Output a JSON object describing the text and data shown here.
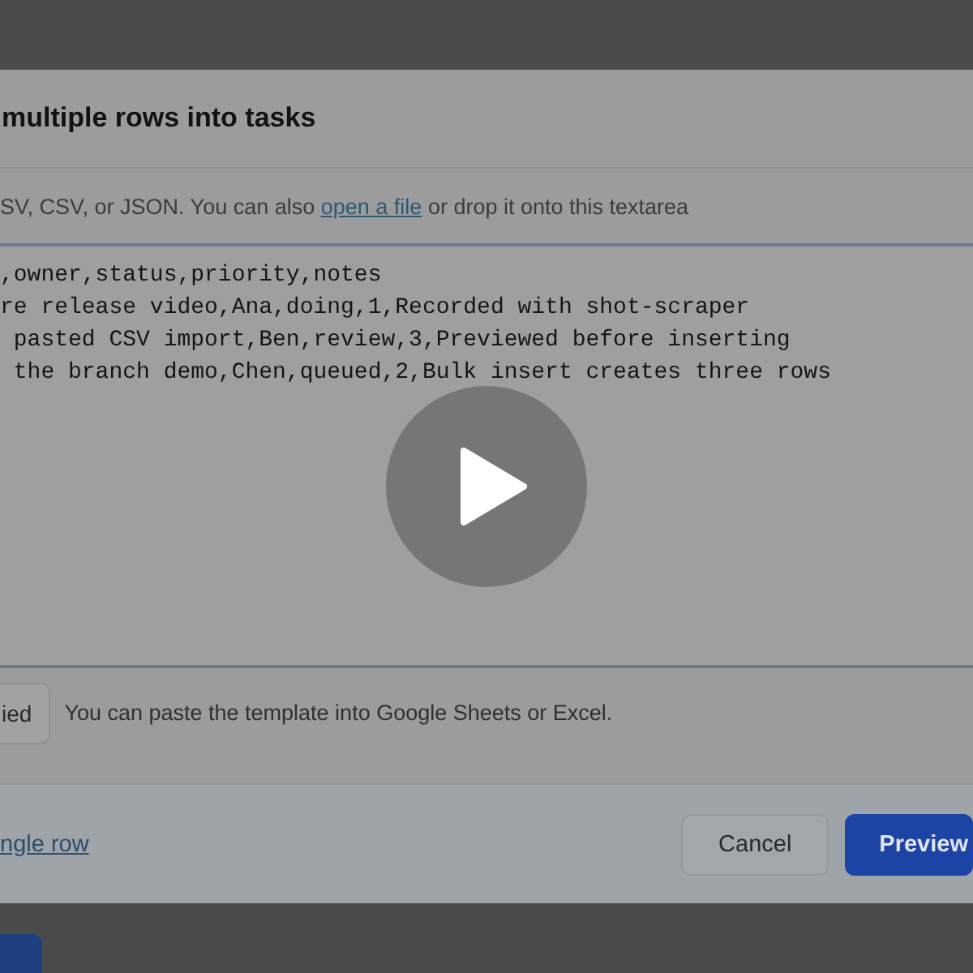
{
  "dialog": {
    "title": "multiple rows into tasks",
    "description": {
      "before": "SV, CSV, or JSON. You can also ",
      "link": "open a file",
      "after": " or drop it onto this textarea"
    },
    "textarea": {
      "lines": [
        ",owner,status,priority,notes",
        "re release video,Ana,doing,1,Recorded with shot-scraper",
        " pasted CSV import,Ben,review,3,Previewed before inserting",
        " the branch demo,Chen,queued,2,Bulk insert creates three rows"
      ]
    },
    "copy_button": "ied",
    "hint": "You can paste the template into Google Sheets or Excel.",
    "footer_link": "ngle row",
    "buttons": [
      {
        "label": "Cancel",
        "kind": "secondary"
      },
      {
        "label": "Preview",
        "kind": "primary"
      }
    ]
  }
}
